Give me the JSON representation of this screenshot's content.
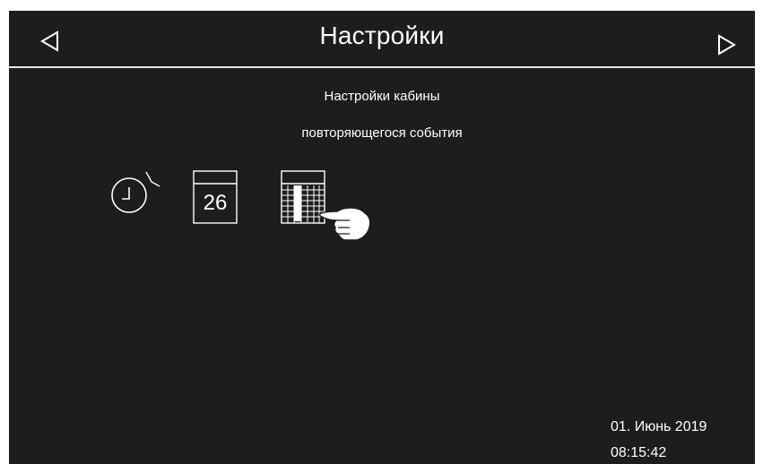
{
  "header": {
    "title": "Настройки",
    "prev_icon": "triangle-left-icon",
    "next_icon": "triangle-right-icon"
  },
  "main": {
    "subtitle_line1": "Настройки кабины",
    "subtitle_line2": "повторяющегося события",
    "icons": [
      {
        "name": "alarm-clock-icon"
      },
      {
        "name": "calendar-day-icon",
        "day": "26"
      },
      {
        "name": "calendar-grid-icon"
      },
      {
        "name": "pointing-hand-icon"
      }
    ]
  },
  "status": {
    "date": "01. Июнь 2019",
    "time": "08:15:42"
  },
  "colors": {
    "background": "#1d1d1d",
    "foreground": "#ffffff"
  }
}
